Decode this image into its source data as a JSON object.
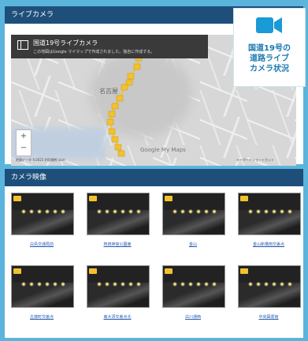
{
  "live": {
    "header": "ライブカメラ",
    "map_title": "国道19号ライブカメラ",
    "map_note": "この地図はGoogle マイマップで作成されました。独自に作成する。",
    "city_label": "名古屋",
    "google_label": "Google My Maps",
    "map_footer": "地図データ ©2021 利用規約 1km",
    "keyboard_label": "キーボードショートカット",
    "zoom_in": "+",
    "zoom_out": "−"
  },
  "badge": {
    "text": "国道19号の\n道路ライブ\nカメラ状況",
    "icon": "video-camera-icon",
    "color": "#1a7ab0"
  },
  "video": {
    "header": "カメラ映像",
    "cameras": [
      {
        "label": "白鳥交通局前"
      },
      {
        "label": "熱田神宮公園東"
      },
      {
        "label": "金山"
      },
      {
        "label": "金山新橋南交差点"
      },
      {
        "label": "古渡町交差点"
      },
      {
        "label": "東大須交差点北"
      },
      {
        "label": "白川通西"
      },
      {
        "label": "中央図書館"
      }
    ]
  },
  "colors": {
    "header_bg": "#1e4f7b",
    "page_bg": "#5ab4dc",
    "marker": "#f2c22e"
  }
}
